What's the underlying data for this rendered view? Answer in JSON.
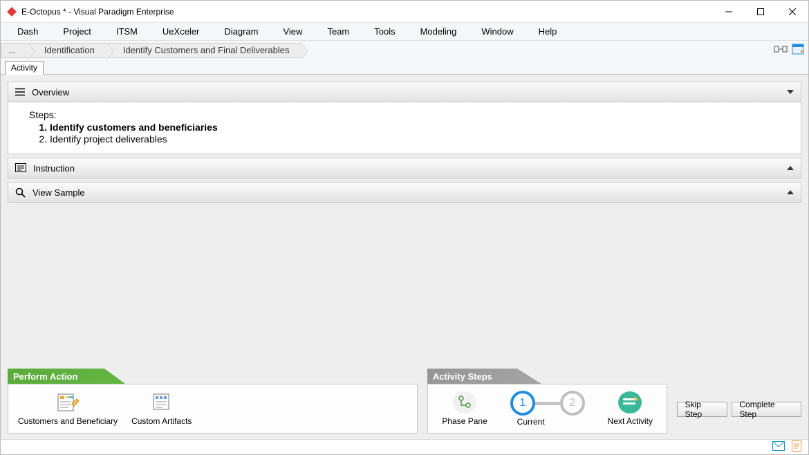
{
  "window": {
    "title": "E-Octopus * - Visual Paradigm Enterprise"
  },
  "menu": {
    "items": [
      "Dash",
      "Project",
      "ITSM",
      "UeXceler",
      "Diagram",
      "View",
      "Team",
      "Tools",
      "Modeling",
      "Window",
      "Help"
    ]
  },
  "breadcrumb": {
    "root": "...",
    "items": [
      "Identification",
      "Identify Customers and Final Deliverables"
    ]
  },
  "tabs": {
    "active": "Activity"
  },
  "panels": {
    "overview": {
      "title": "Overview",
      "steps_label": "Steps:",
      "steps": [
        {
          "text": "Identify customers and beneficiaries",
          "current": true
        },
        {
          "text": "Identify project deliverables",
          "current": false
        }
      ]
    },
    "instruction": {
      "title": "Instruction"
    },
    "view_sample": {
      "title": "View Sample"
    }
  },
  "perform_action": {
    "title": "Perform Action",
    "items": [
      {
        "label": "Customers and Beneficiary"
      },
      {
        "label": "Custom Artifacts"
      }
    ]
  },
  "activity_steps": {
    "title": "Activity Steps",
    "phase_pane_label": "Phase Pane",
    "current_label": "Current",
    "step_numbers": [
      "1",
      "2"
    ],
    "next_activity_label": "Next Activity"
  },
  "buttons": {
    "skip": "Skip Step",
    "complete": "Complete Step"
  }
}
